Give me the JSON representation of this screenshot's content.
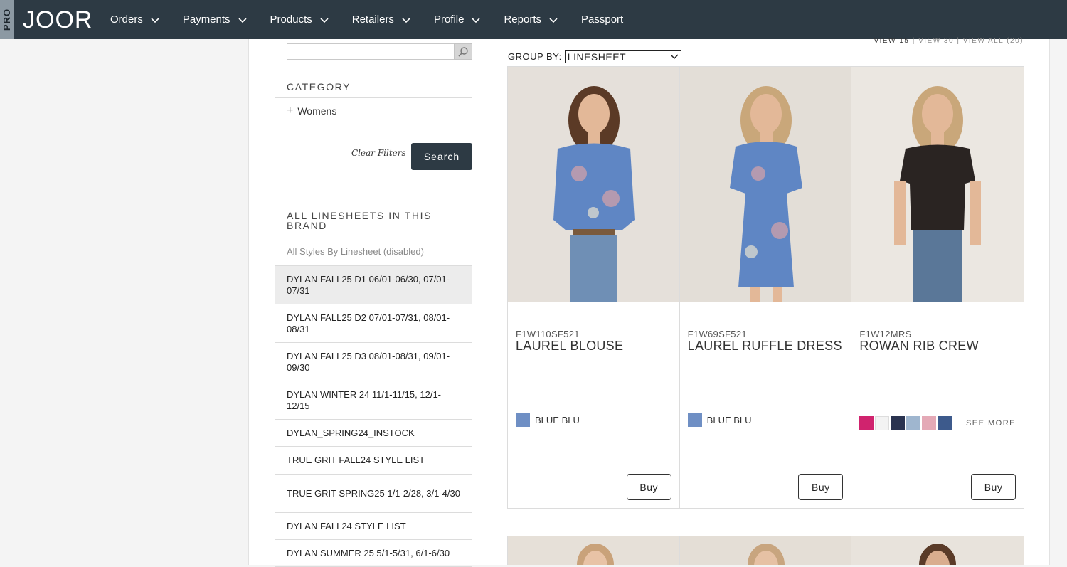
{
  "app": {
    "pro_label": "PRO",
    "logo_text": "JOOR"
  },
  "nav": [
    {
      "label": "Orders",
      "has_dropdown": true
    },
    {
      "label": "Payments",
      "has_dropdown": true
    },
    {
      "label": "Products",
      "has_dropdown": true
    },
    {
      "label": "Retailers",
      "has_dropdown": true
    },
    {
      "label": "Profile",
      "has_dropdown": true
    },
    {
      "label": "Reports",
      "has_dropdown": true
    },
    {
      "label": "Passport",
      "has_dropdown": false
    }
  ],
  "sidebar": {
    "search": {
      "value": "",
      "placeholder": ""
    },
    "category_title": "CATEGORY",
    "category_item": "Womens",
    "clear_filters": "Clear Filters",
    "search_button": "Search",
    "linesheets_title": "ALL LINESHEETS IN THIS BRAND",
    "linesheets": [
      {
        "label": "All Styles By Linesheet (disabled)",
        "state": "disabled"
      },
      {
        "label": "DYLAN FALL25 D1 06/01-06/30, 07/01-07/31",
        "state": "active"
      },
      {
        "label": "DYLAN FALL25 D2 07/01-07/31, 08/01-08/31",
        "state": "normal"
      },
      {
        "label": "DYLAN FALL25 D3 08/01-08/31, 09/01-09/30",
        "state": "normal"
      },
      {
        "label": "DYLAN WINTER 24 11/1-11/15, 12/1-12/15",
        "state": "normal"
      },
      {
        "label": "DYLAN_SPRING24_INSTOCK",
        "state": "normal"
      },
      {
        "label": "TRUE GRIT FALL24 STYLE LIST",
        "state": "normal"
      },
      {
        "label": "TRUE GRIT SPRING25 1/1-2/28, 3/1-4/30",
        "state": "normal"
      },
      {
        "label": "DYLAN FALL24 STYLE LIST",
        "state": "normal"
      },
      {
        "label": "DYLAN SUMMER 25 5/1-5/31, 6/1-6/30",
        "state": "normal"
      }
    ]
  },
  "toolbar": {
    "group_by_label": "GROUP BY:",
    "group_by_value": "LINESHEET",
    "view_15": "VIEW 15",
    "view_30": "VIEW 30",
    "view_all": "VIEW ALL (20)",
    "separator": "|"
  },
  "products": [
    {
      "sku": "F1W110SF521",
      "name": "LAUREL BLOUSE",
      "color_name": "BLUE BLU",
      "swatch": "#6f8fc4",
      "buy_label": "Buy",
      "garment": "blouse"
    },
    {
      "sku": "F1W69SF521",
      "name": "LAUREL RUFFLE DRESS",
      "color_name": "BLUE BLU",
      "swatch": "#6f8fc4",
      "buy_label": "Buy",
      "garment": "dress"
    },
    {
      "sku": "F1W12MRS",
      "name": "ROWAN RIB CREW",
      "swatches": [
        "#d0236e",
        "#f3f3f3",
        "#2a3350",
        "#9fb6cf",
        "#e4a9b6",
        "#3d5a8c"
      ],
      "see_more": "SEE MORE",
      "buy_label": "Buy",
      "garment": "tee"
    }
  ],
  "colors": {
    "topbar": "#2d3a44",
    "accent_button": "#2d3a44"
  }
}
